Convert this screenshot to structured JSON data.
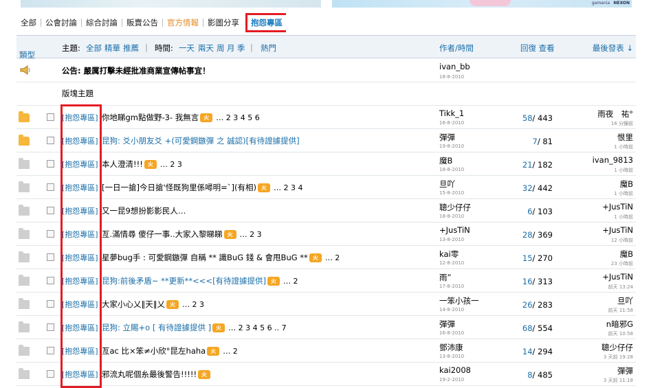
{
  "banner": {
    "brand1": "gamania",
    "brand2": "NEXON"
  },
  "tabs": [
    "全部",
    "公會討論",
    "綜合討論",
    "販賣公告",
    "官方情報",
    "影圖分享",
    "抱怨專區"
  ],
  "header": {
    "type_label": "類型",
    "topic_label": "主題:",
    "filter_all": "全部",
    "filter_digest": "精華",
    "filter_recommend": "推薦",
    "time_label": "時間:",
    "time_1d": "一天",
    "time_2d": "兩天",
    "time_week": "周",
    "time_month": "月",
    "time_season": "季",
    "hot_label": "熱門",
    "author_col": "作者/時間",
    "reply_view_col": "回復 查看",
    "last_post_col": "最後發表 ↓"
  },
  "notice": {
    "text": "公告: 嚴厲打擊未經批准商業宣傳帖事宜！",
    "author": "ivan_bb",
    "date": "18-8-2010"
  },
  "section_label": "版塊主題",
  "threads": [
    {
      "icon": "folder",
      "tag": "[抱怨專區]",
      "subject": "你地睇gm點做野-3- 我無言",
      "style": "",
      "hot": true,
      "pages": "… 2 3 4 5 6",
      "author": "Tikk_1",
      "date": "16-8-2010",
      "replies": "58",
      "views": "443",
      "last_user": "雨夜　祐°",
      "last_time": "16 分鐘前"
    },
    {
      "icon": "folder",
      "tag": "[抱怨專區]",
      "subject": "昆狗: 爻小朋友爻 +(可愛鋼鏃彈 之 誠認)[有待證據提供]",
      "style": "s",
      "hot": false,
      "pages": "",
      "author": "彈彈",
      "date": "19-8-2010",
      "replies": "7",
      "views": "81",
      "last_user": "恨里",
      "last_time": "1 小時前"
    },
    {
      "icon": "gray",
      "tag": "[抱怨專區]",
      "subject": "本人澄清!!!",
      "style": "",
      "hot": true,
      "pages": "… 2 3",
      "author": "魔B",
      "date": "18-8-2010",
      "replies": "21",
      "views": "182",
      "last_user": "ivan_9813",
      "last_time": "1 小時前"
    },
    {
      "icon": "gray",
      "tag": "[抱怨專區]",
      "subject": "[一日一搶]今日搶'怪既狗里係噚明=`](有相)",
      "style": "",
      "hot": true,
      "pages": "… 2 3 4",
      "author": "旦吖",
      "date": "15-8-2010",
      "replies": "32",
      "views": "442",
      "last_user": "魔B",
      "last_time": "1 小時前"
    },
    {
      "icon": "gray",
      "tag": "[抱怨專區]",
      "subject": "又一昆9想扮影影民人…",
      "style": "",
      "hot": false,
      "pages": "",
      "author": "聰少仔仔",
      "date": "18-8-2010",
      "replies": "6",
      "views": "103",
      "last_user": "+JusTiN",
      "last_time": "1 小時前"
    },
    {
      "icon": "gray",
      "tag": "[抱怨專區]",
      "subject": "亙.滿情尋 傻仔一事..大家入黎睇睇",
      "style": "",
      "hot": true,
      "pages": "… 2 3",
      "author": "+JusTiN",
      "date": "13-8-2010",
      "replies": "28",
      "views": "369",
      "last_user": "+JusTiN",
      "last_time": "12 小時前"
    },
    {
      "icon": "gray",
      "tag": "[抱怨專區]",
      "subject": "星夢bug手 : 可愛鋼鏃彈 自稱 ** 識BuG 錢 & 會甩BuG **",
      "style": "",
      "hot": true,
      "pages": "… 2",
      "author": "kai零",
      "date": "12-8-2010",
      "replies": "15",
      "views": "270",
      "last_user": "魔B",
      "last_time": "23 小時前"
    },
    {
      "icon": "gray",
      "tag": "[抱怨專區]",
      "subject": "昆狗:前後矛盾~ **更新**<<<[有待證據提供]",
      "style": "s",
      "hot": true,
      "pages": "… 2",
      "author": "雨”",
      "date": "17-8-2010",
      "replies": "16",
      "views": "313",
      "last_user": "+JusTiN",
      "last_time": "前天 13:24"
    },
    {
      "icon": "gray",
      "tag": "[抱怨專區]",
      "subject": "大家小心乂‖天‖乂",
      "style": "",
      "hot": true,
      "pages": "… 2 3",
      "author": "一笨小孩一",
      "date": "14-8-2010",
      "replies": "26",
      "views": "283",
      "last_user": "旦吖",
      "last_time": "前天 11:58"
    },
    {
      "icon": "gray",
      "tag": "[抱怨專區]",
      "subject": "昆狗: 立賜+o [ 有待證據提供 ]",
      "style": "s",
      "hot": true,
      "pages": "… 2 3 4 5 6 .. 7",
      "author": "彈彈",
      "date": "16-8-2010",
      "replies": "68",
      "views": "554",
      "last_user": "n暗邪G",
      "last_time": "前天 10:58"
    },
    {
      "icon": "gray",
      "tag": "[抱怨專區]",
      "subject": "亙ac 比×笨≠小欣°昆左haha",
      "style": "",
      "hot": true,
      "pages": "… 2",
      "author": "鄧沛康",
      "date": "13-8-2010",
      "replies": "14",
      "views": "294",
      "last_user": "聰少仔仔",
      "last_time": "3 天前 19:28"
    },
    {
      "icon": "gray",
      "tag": "[抱怨專區]",
      "subject": "邪流丸呢個糸最後警告!!!!!",
      "style": "",
      "hot": true,
      "pages": "",
      "author": "kai2008",
      "date": "19-2-2010",
      "replies": "8",
      "views": "485",
      "last_user": "彈彈",
      "last_time": "3 天前 11:18"
    }
  ],
  "hot_badge": "火",
  "colors": {
    "accent": "#1a6ea8",
    "highlight": "#e31b23",
    "folder": "#f6b73c",
    "official": "#e28a1f"
  }
}
